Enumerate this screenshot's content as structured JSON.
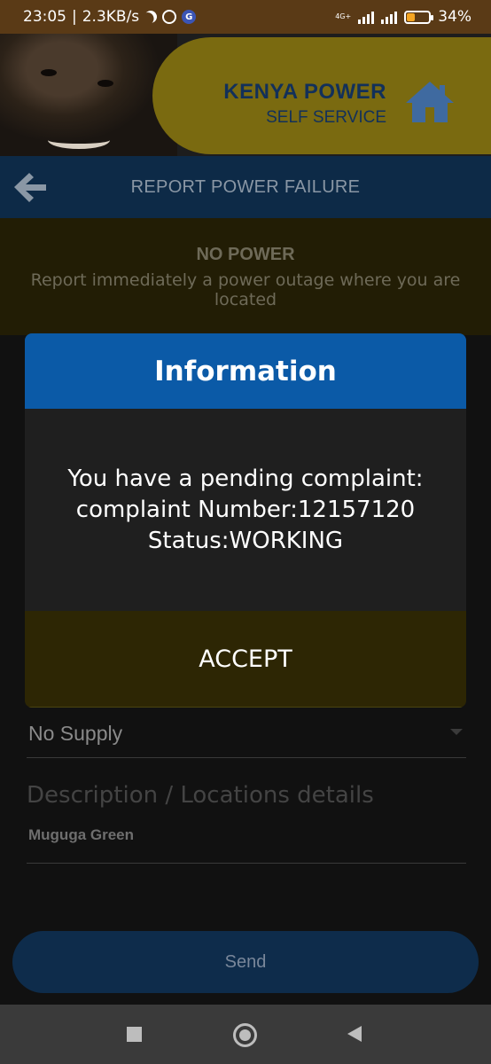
{
  "status_bar": {
    "time": "23:05",
    "network_speed": "2.3KB/s",
    "separator": "|",
    "battery_percent": "34%",
    "mobile_data_type": "4G+",
    "icons": [
      "moon-icon",
      "alarm-icon",
      "g-badge-icon",
      "signal-icon",
      "signal-icon",
      "battery-icon"
    ]
  },
  "header": {
    "brand_title": "KENYA POWER",
    "brand_subtitle": "SELF SERVICE",
    "brand_color": "#12305a",
    "accent_color": "#7a6a10"
  },
  "titlebar": {
    "title": "REPORT POWER FAILURE",
    "back_icon": "arrow-left-icon"
  },
  "notice": {
    "title": "NO POWER",
    "subtitle": "Report immediately a power outage where you are located"
  },
  "form": {
    "fault_type_value": "No Supply",
    "description_label": "Description / Locations details",
    "description_value": "Muguga Green",
    "send_label": "Send"
  },
  "dialog": {
    "title": "Information",
    "message_lines": [
      "You have a pending complaint:",
      "complaint Number:12157120",
      "Status:WORKING"
    ],
    "accept_label": "ACCEPT",
    "header_color": "#0b5aa7"
  },
  "navbar": {
    "icons": [
      "recent-apps-icon",
      "home-button-icon",
      "back-button-icon"
    ]
  }
}
